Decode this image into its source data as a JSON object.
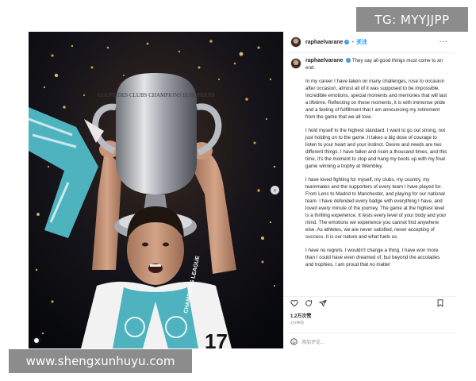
{
  "watermarks": {
    "top_right": "TG: MYYJJPP",
    "bottom_left": "www.shengxunhuyu.com"
  },
  "post": {
    "username": "raphaelvarane",
    "follow_label": "关注",
    "more_label": "···",
    "trophy_engraving": "COUPE DES CLUBS CHAMPIONS EUROPEENS",
    "scarf_text": "CHAMPIONS LEAGUE",
    "jersey_number": "17",
    "caption_lead": "They say all good things must come to an end.",
    "caption_paragraphs": [
      "In my career I have taken on many challenges, rose to occasion after occasion, almost all of it was supposed to be impossible. Incredible emotions, special moments and memories that will last a lifetime. Reflecting on these moments, it is with immense pride and a feeling of fulfillment that I am announcing my retirement from the game that we all love.",
      "I hold myself to the highest standard. I want to go out strong, not just holding on to the game. It takes a big dose of courage to listen to your heart and your instinct. Desire and needs are two different things. I have fallen and risen a thousand times, and this time, it's the moment to stop and hang my boots up with my final game winning a trophy at Wembley.",
      "I have loved fighting for myself, my clubs, my country, my teammates and the supporters of every team I have played for. From Lens to Madrid to Manchester, and playing for our national team. I have defended every badge with everything I have, and loved every minute of the journey. The game at the highest level is a thrilling experience. It tests every level of your body and your mind. The emotions we experience you cannot find anywhere else. As athletes, we are never satisfied, never accepting of success. It is our nature and what fuels us.",
      "I have no regrets. I wouldn't change a thing. I have won more than I could have even dreamed of, but beyond the accolades and trophies, I am proud that no matter"
    ],
    "likes": "1.2万次赞",
    "date": "2分钟前",
    "comment_placeholder": "添加评论..."
  },
  "icons": {
    "like": "heart-icon",
    "comment": "comment-icon",
    "share": "share-icon",
    "save": "bookmark-icon",
    "emoji": "emoji-icon",
    "next": "chevron-right-icon",
    "verified": "verified-badge-icon"
  },
  "colors": {
    "accent_blue": "#0095f6",
    "verified_blue": "#3897f0",
    "scarf_teal": "#4fb3bf",
    "watermark_gray": "#8c8c8c"
  }
}
